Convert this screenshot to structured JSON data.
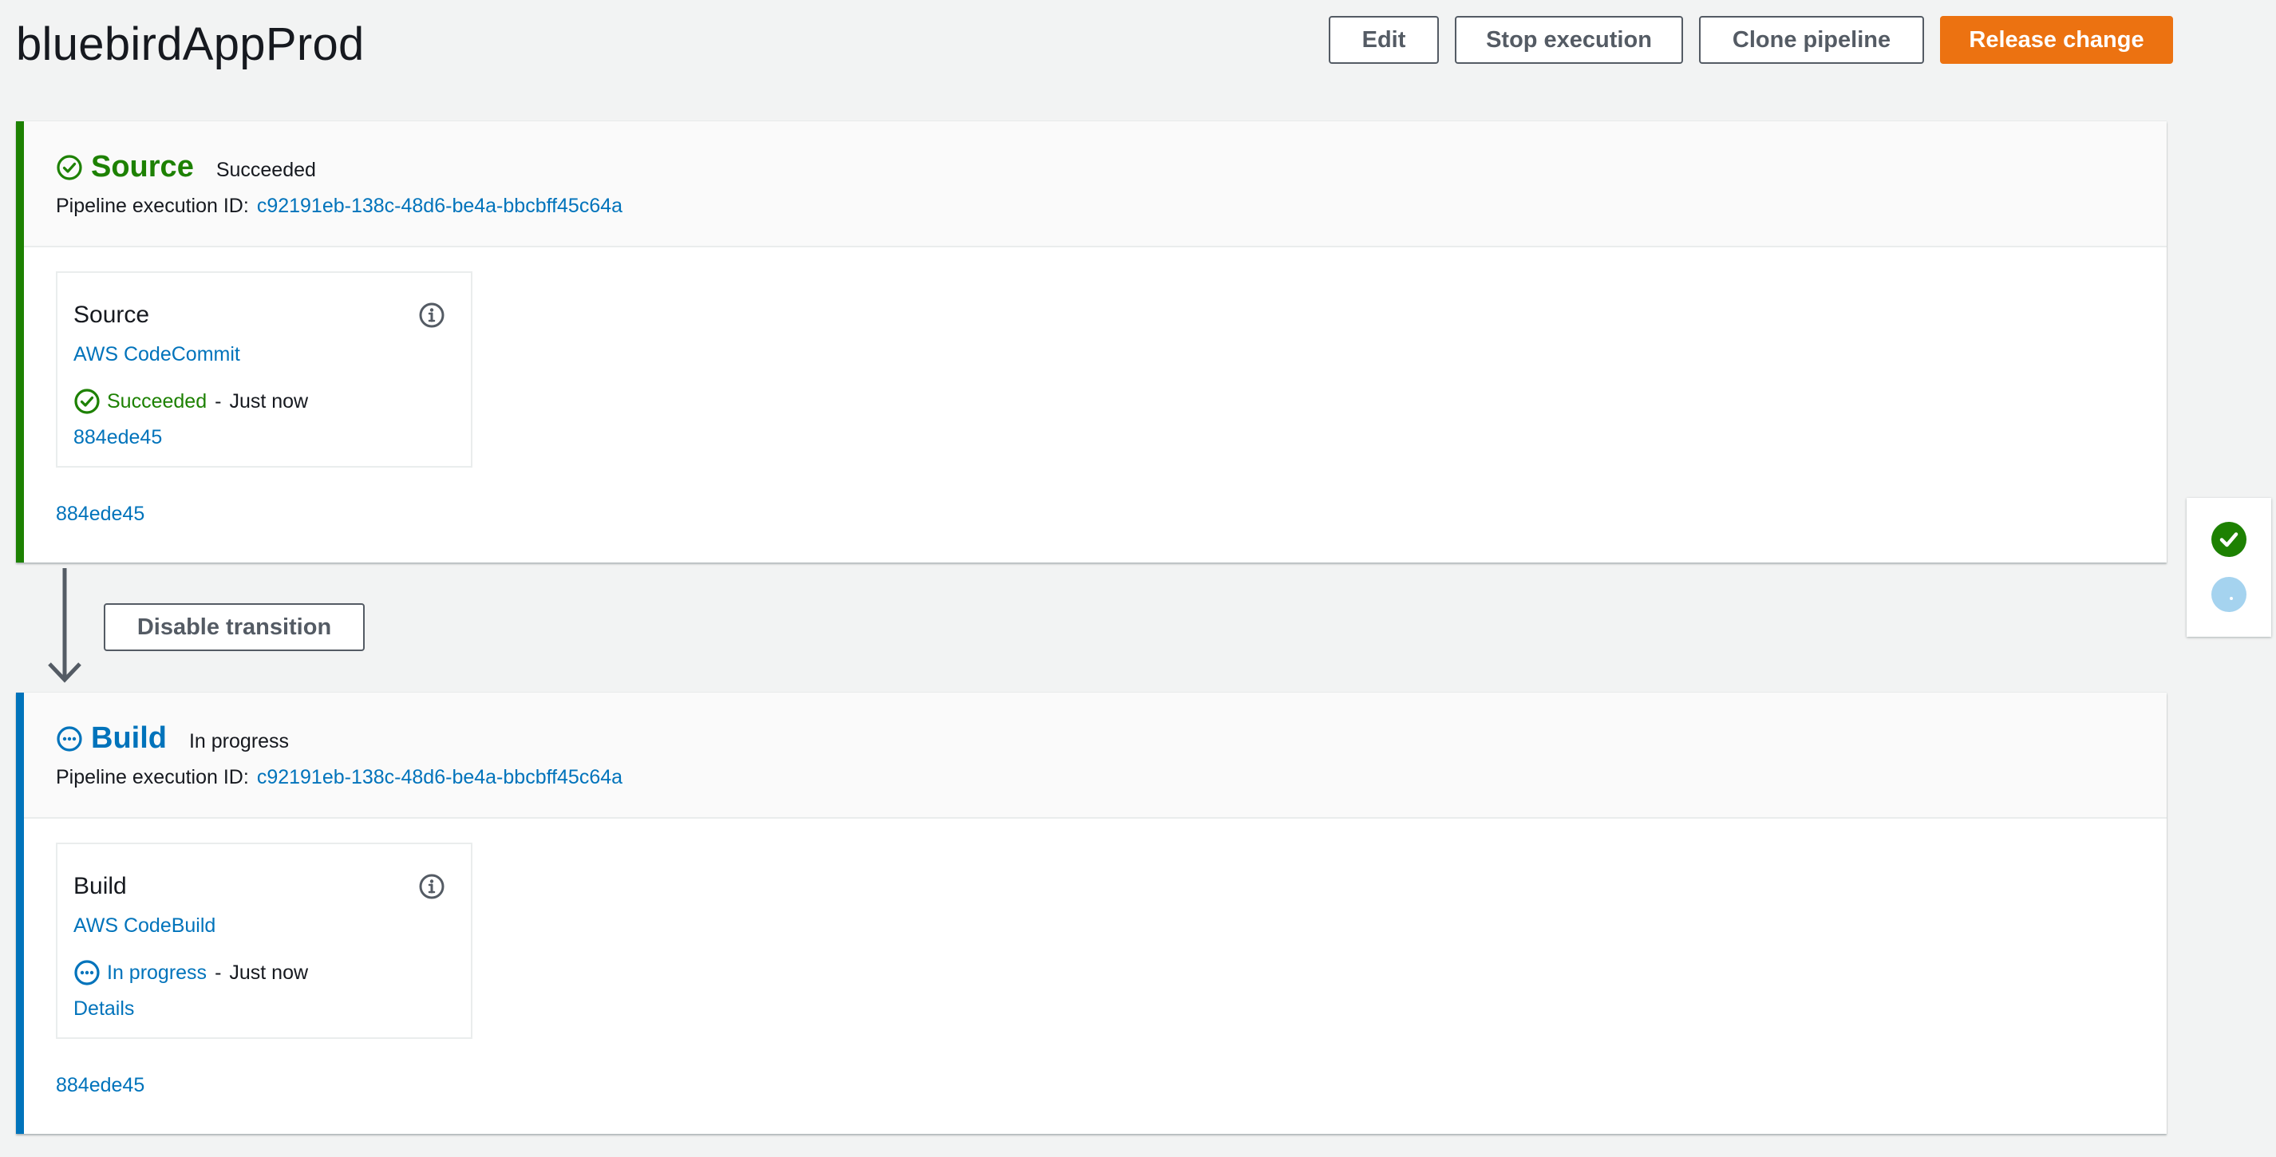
{
  "header": {
    "title": "bluebirdAppProd",
    "buttons": {
      "edit": "Edit",
      "stop": "Stop execution",
      "clone": "Clone pipeline",
      "release": "Release change"
    }
  },
  "colors": {
    "success": "#1d8102",
    "in_progress": "#0073bb",
    "primary_button": "#ec7211",
    "background": "#f2f3f3"
  },
  "stages": [
    {
      "name": "Source",
      "status": "Succeeded",
      "status_icon": "check-circle-icon",
      "execution_id_label": "Pipeline execution ID:",
      "execution_id": "c92191eb-138c-48d6-be4a-bbcbff45c64a",
      "action": {
        "name": "Source",
        "provider": "AWS CodeCommit",
        "status": "Succeeded",
        "separator": "-",
        "time": "Just now",
        "link": "884ede45"
      },
      "footer_link": "884ede45"
    },
    {
      "name": "Build",
      "status": "In progress",
      "status_icon": "in-progress-icon",
      "execution_id_label": "Pipeline execution ID:",
      "execution_id": "c92191eb-138c-48d6-be4a-bbcbff45c64a",
      "action": {
        "name": "Build",
        "provider": "AWS CodeBuild",
        "status": "In progress",
        "separator": "-",
        "time": "Just now",
        "link": "Details"
      },
      "footer_link": "884ede45"
    }
  ],
  "transition": {
    "button": "Disable transition"
  },
  "side_panel": {
    "items": [
      {
        "state": "Succeeded",
        "icon": "check-circle-filled-icon"
      },
      {
        "state": "In progress",
        "icon": "in-progress-dot-icon"
      }
    ]
  }
}
